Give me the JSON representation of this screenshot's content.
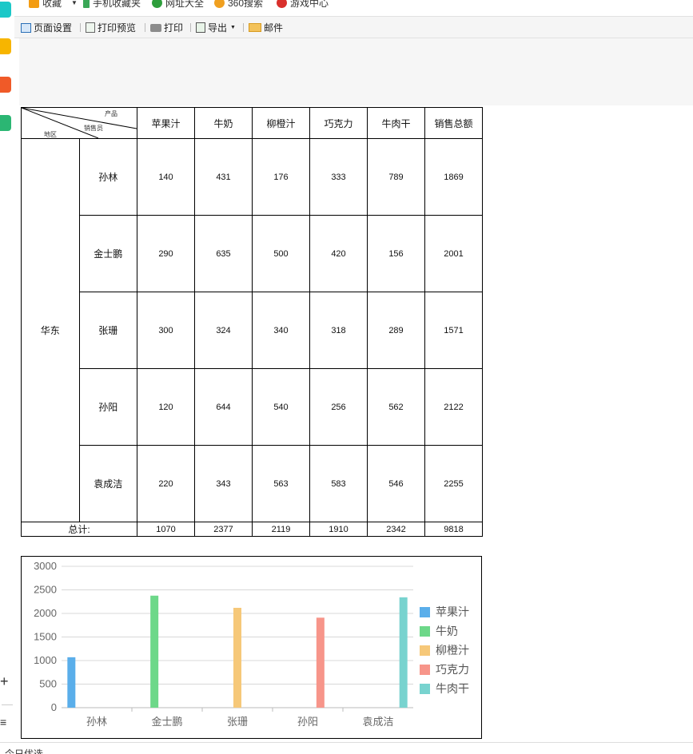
{
  "favbar": {
    "items": [
      "收藏",
      "手机收藏夹",
      "网址大全",
      "360搜索",
      "游戏中心"
    ]
  },
  "toolbar": {
    "page_setup": "页面设置",
    "print_preview": "打印预览",
    "print": "打印",
    "export": "导出",
    "mail": "邮件"
  },
  "report": {
    "corner": {
      "product": "产品",
      "salesperson": "销售员",
      "region": "地区"
    },
    "headers": [
      "苹果汁",
      "牛奶",
      "柳橙汁",
      "巧克力",
      "牛肉干",
      "销售总额"
    ],
    "region": "华东",
    "rows": [
      {
        "name": "孙林",
        "values": [
          "140",
          "431",
          "176",
          "333",
          "789",
          "1869"
        ]
      },
      {
        "name": "金士鹏",
        "values": [
          "290",
          "635",
          "500",
          "420",
          "156",
          "2001"
        ]
      },
      {
        "name": "张珊",
        "values": [
          "300",
          "324",
          "340",
          "318",
          "289",
          "1571"
        ]
      },
      {
        "name": "孙阳",
        "values": [
          "120",
          "644",
          "540",
          "256",
          "562",
          "2122"
        ]
      },
      {
        "name": "袁成洁",
        "values": [
          "220",
          "343",
          "563",
          "583",
          "546",
          "2255"
        ]
      }
    ],
    "total_label": "总计:",
    "totals": [
      "1070",
      "2377",
      "2119",
      "1910",
      "2342",
      "9818"
    ]
  },
  "chart_data": {
    "type": "bar",
    "categories": [
      "孙林",
      "金士鹏",
      "张珊",
      "孙阳",
      "袁成洁"
    ],
    "series": [
      {
        "name": "苹果汁",
        "color": "#5aaeea",
        "values": [
          1070,
          0,
          0,
          0,
          0
        ]
      },
      {
        "name": "牛奶",
        "color": "#6dd889",
        "values": [
          0,
          2377,
          0,
          0,
          0
        ]
      },
      {
        "name": "柳橙汁",
        "color": "#f6c879",
        "values": [
          0,
          0,
          2119,
          0,
          0
        ]
      },
      {
        "name": "巧克力",
        "color": "#f7958a",
        "values": [
          0,
          0,
          0,
          1910,
          0
        ]
      },
      {
        "name": "牛肉干",
        "color": "#78d3cf",
        "values": [
          0,
          0,
          0,
          0,
          2342
        ]
      }
    ],
    "yticks": [
      0,
      500,
      1000,
      1500,
      2000,
      2500,
      3000
    ],
    "ylim": [
      0,
      3000
    ],
    "grid": true,
    "legend": "right"
  },
  "bottom": {
    "text": "今日优选"
  },
  "colors": {
    "sidebar_icons": [
      "#1bc8c8",
      "#f7b500",
      "#f05a28",
      "#2bb673"
    ]
  }
}
